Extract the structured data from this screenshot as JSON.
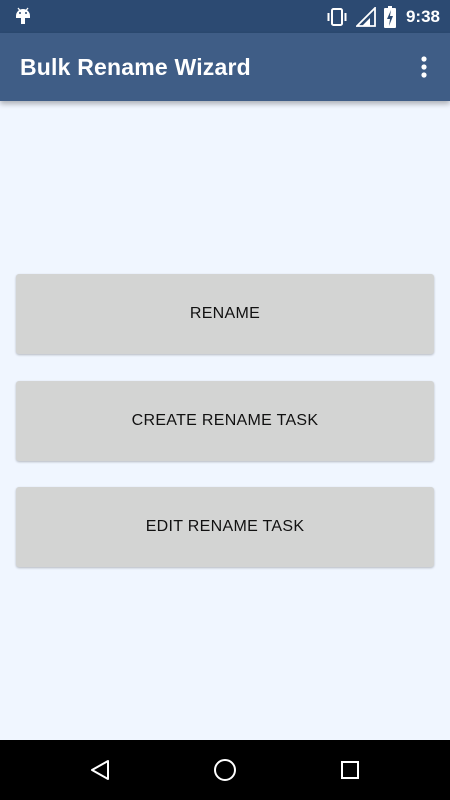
{
  "status_bar": {
    "time": "9:38",
    "icons": [
      "android-icon",
      "vibrate-icon",
      "signal-icon",
      "battery-charging-icon"
    ]
  },
  "app_bar": {
    "title": "Bulk Rename Wizard",
    "menu_icon": "more-vert-icon"
  },
  "buttons": {
    "rename": "RENAME",
    "create_task": "CREATE RENAME TASK",
    "edit_task": "EDIT RENAME TASK"
  },
  "nav_bar": {
    "icons": [
      "back-icon",
      "home-icon",
      "recents-icon"
    ]
  },
  "colors": {
    "status_bar": "#2c4a72",
    "app_bar": "#3f5d86",
    "background": "#f0f6ff",
    "button": "#d3d4d3"
  }
}
